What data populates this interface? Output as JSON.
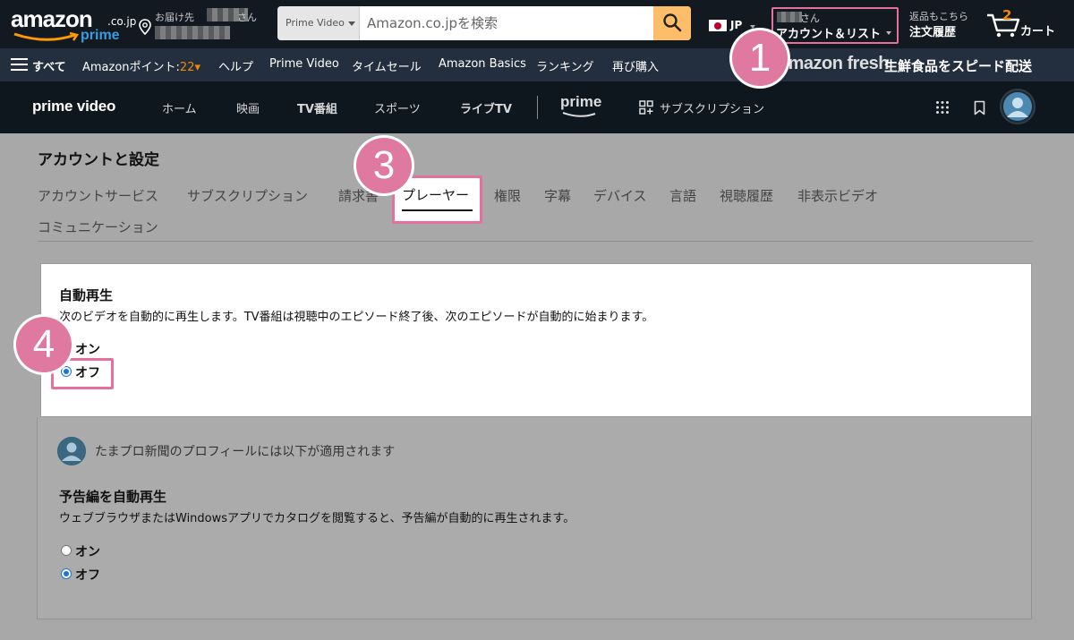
{
  "header": {
    "logo_text": "amazon",
    "logo_tld": ".co.jp",
    "logo_sub": "prime",
    "deliver_label": "お届け先",
    "deliver_suffix": "さん",
    "search_category": "Prime Video",
    "search_placeholder": "Amazon.co.jpを検索",
    "lang_code": "JP",
    "account_greeting": "さん",
    "account_label": "アカウント＆リスト",
    "orders_line1": "返品もこちら",
    "orders_line2": "注文履歴",
    "cart_count": "2",
    "cart_label": "カート"
  },
  "subnav": {
    "all": "すべて",
    "points_label": "Amazonポイント:",
    "points_value": "22",
    "items": [
      "ヘルプ",
      "Prime Video",
      "タイムセール",
      "Amazon Basics",
      "ランキング",
      "再び購入"
    ],
    "fresh_logo": "amazon fresh",
    "fresh_tagline": "生鮮食品をスピード配送"
  },
  "pv_nav": {
    "logo": "prime video",
    "items": [
      "ホーム",
      "映画",
      "TV番組",
      "スポーツ",
      "ライブTV"
    ],
    "prime": "prime",
    "subscriptions": "サブスクリプション"
  },
  "settings": {
    "title": "アカウントと設定",
    "tabs": [
      "アカウントサービス",
      "サブスクリプション",
      "請求書",
      "プレーヤー",
      "権限",
      "字幕",
      "デバイス",
      "言語",
      "視聴履歴",
      "非表示ビデオ",
      "コミュニケーション"
    ],
    "active_tab": "プレーヤー"
  },
  "autoplay": {
    "title": "自動再生",
    "description": "次のビデオを自動的に再生します。TV番組は視聴中のエピソード終了後、次のエピソードが自動的に始まります。",
    "option_on": "オン",
    "option_off": "オフ",
    "selected": "オフ"
  },
  "profile": {
    "notice": "たまプロ新聞のプロフィールには以下が適用されます"
  },
  "trailer": {
    "title": "予告編を自動再生",
    "description": "ウェブブラウザまたはWindowsアプリでカタログを閲覧すると、予告編が自動的に再生されます。",
    "option_on": "オン",
    "option_off": "オフ",
    "selected": "オフ"
  },
  "badges": [
    "1",
    "3",
    "4"
  ],
  "colors": {
    "highlight": "#e4719d",
    "badge": "#e079a0",
    "search_button": "#febd69",
    "accent_orange": "#f08804",
    "radio_checked": "#1a73e8"
  }
}
